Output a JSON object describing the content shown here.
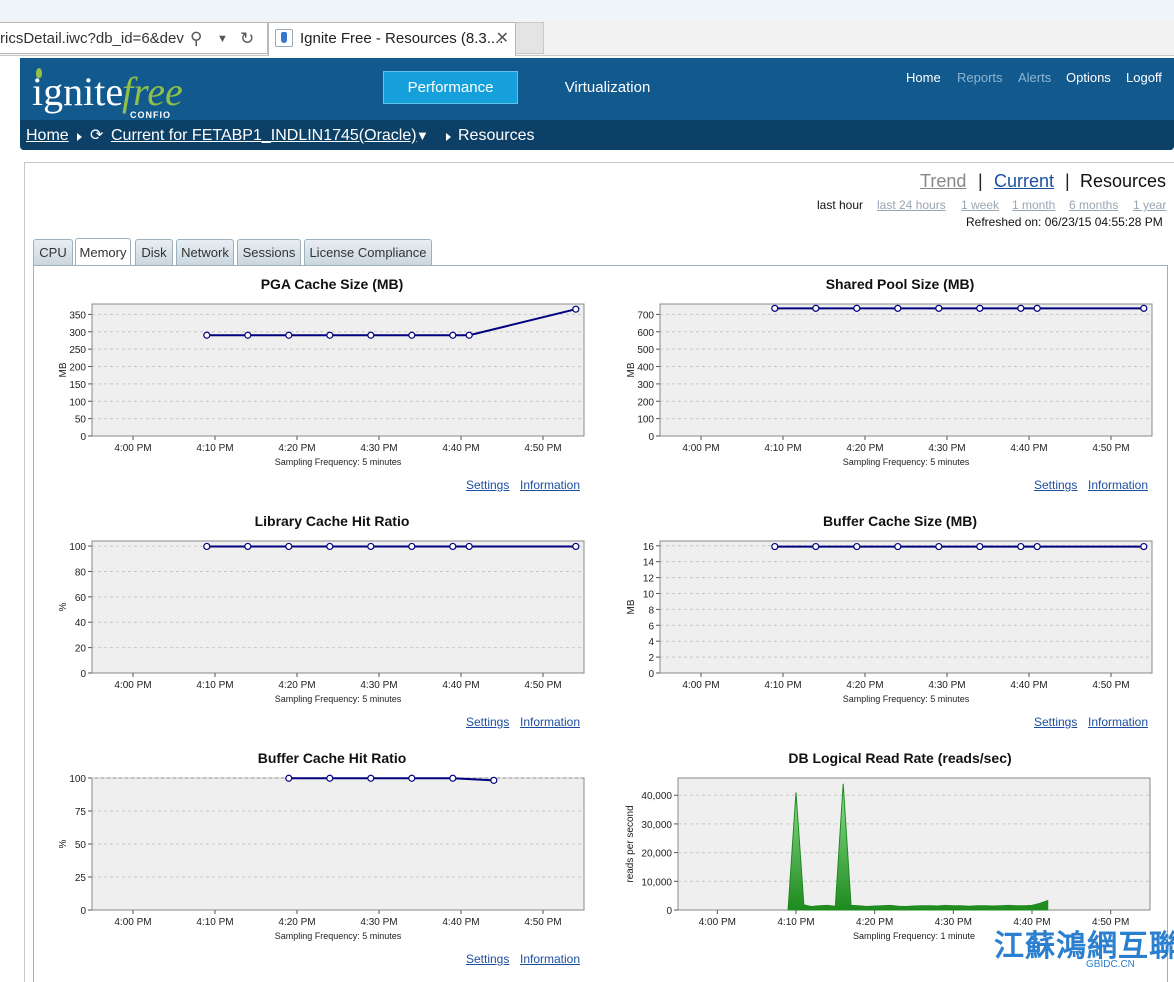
{
  "browser": {
    "address_text": "ricsDetail.iwc?db_id=6&dev",
    "tab_title": "Ignite Free - Resources (8.3....",
    "tab_close": "✕"
  },
  "header": {
    "logo_text_main": "ignite",
    "logo_text_accent": "free",
    "logo_sub": "CONFIO",
    "nav": [
      "Performance",
      "Virtualization"
    ],
    "top_links": [
      "Home",
      "Reports",
      "Alerts",
      "Options",
      "Logoff"
    ]
  },
  "breadcrumb": {
    "home": "Home",
    "current": "Current for FETABP1_INDLIN1745(Oracle)",
    "dropdown": "▼",
    "page": "Resources"
  },
  "view": {
    "trend": "Trend",
    "separator": "|",
    "current": "Current",
    "resources": "Resources"
  },
  "ranges": [
    "last hour",
    "last 24 hours",
    "1 week",
    "1 month",
    "6 months",
    "1 year"
  ],
  "refreshed": "Refreshed on: 06/23/15 04:55:28 PM",
  "tabs": [
    "CPU",
    "Memory",
    "Disk",
    "Network",
    "Sessions",
    "License Compliance"
  ],
  "links": {
    "settings": "Settings",
    "information": "Information"
  },
  "colors": {
    "line": "#00007f",
    "area": "#33aa33",
    "plot_bg": "#efefef",
    "header": "#12598e",
    "accent": "#16a0db"
  },
  "watermark": {
    "text": "江蘇鴻網互聯",
    "sub": "GBIDC.CN"
  },
  "chart_data": [
    {
      "type": "line",
      "title": "PGA Cache Size (MB)",
      "ylabel": "MB",
      "xlabel": "Sampling Frequency: 5 minutes",
      "x_ticks": [
        "4:00 PM",
        "4:10 PM",
        "4:20 PM",
        "4:30 PM",
        "4:40 PM",
        "4:50 PM"
      ],
      "xlim": [
        55,
        115
      ],
      "y_ticks": [
        0,
        50,
        100,
        150,
        200,
        250,
        300,
        350
      ],
      "ylim": [
        0,
        380
      ],
      "x": [
        69,
        74,
        79,
        84,
        89,
        94,
        99,
        101,
        114
      ],
      "y": [
        290,
        290,
        290,
        290,
        290,
        290,
        290,
        290,
        365
      ]
    },
    {
      "type": "line",
      "title": "Shared Pool Size (MB)",
      "ylabel": "MB",
      "xlabel": "Sampling Frequency: 5 minutes",
      "x_ticks": [
        "4:00 PM",
        "4:10 PM",
        "4:20 PM",
        "4:30 PM",
        "4:40 PM",
        "4:50 PM"
      ],
      "xlim": [
        55,
        115
      ],
      "y_ticks": [
        0,
        100,
        200,
        300,
        400,
        500,
        600,
        700
      ],
      "ylim": [
        0,
        760
      ],
      "x": [
        69,
        74,
        79,
        84,
        89,
        94,
        99,
        101,
        114
      ],
      "y": [
        735,
        735,
        735,
        735,
        735,
        735,
        735,
        735,
        735
      ]
    },
    {
      "type": "line",
      "title": "Library Cache Hit Ratio",
      "ylabel": "%",
      "xlabel": "Sampling Frequency: 5 minutes",
      "x_ticks": [
        "4:00 PM",
        "4:10 PM",
        "4:20 PM",
        "4:30 PM",
        "4:40 PM",
        "4:50 PM"
      ],
      "xlim": [
        55,
        115
      ],
      "y_ticks": [
        0,
        20,
        40,
        60,
        80,
        100
      ],
      "ylim": [
        0,
        104
      ],
      "x": [
        69,
        74,
        79,
        84,
        89,
        94,
        99,
        101,
        114
      ],
      "y": [
        99.7,
        99.7,
        99.7,
        99.7,
        99.7,
        99.7,
        99.7,
        99.7,
        99.7
      ]
    },
    {
      "type": "line",
      "title": "Buffer Cache Size (MB)",
      "ylabel": "MB",
      "xlabel": "Sampling Frequency: 5 minutes",
      "x_ticks": [
        "4:00 PM",
        "4:10 PM",
        "4:20 PM",
        "4:30 PM",
        "4:40 PM",
        "4:50 PM"
      ],
      "xlim": [
        55,
        115
      ],
      "y_ticks": [
        0,
        2,
        4,
        6,
        8,
        10,
        12,
        14,
        16
      ],
      "ylim": [
        0,
        16.6
      ],
      "x": [
        69,
        74,
        79,
        84,
        89,
        94,
        99,
        101,
        114
      ],
      "y": [
        15.9,
        15.9,
        15.9,
        15.9,
        15.9,
        15.9,
        15.9,
        15.9,
        15.9
      ]
    },
    {
      "type": "line",
      "title": "Buffer Cache Hit Ratio",
      "ylabel": "%",
      "xlabel": "Sampling Frequency: 5 minutes",
      "x_ticks": [
        "4:00 PM",
        "4:10 PM",
        "4:20 PM",
        "4:30 PM",
        "4:40 PM",
        "4:50 PM"
      ],
      "xlim": [
        55,
        115
      ],
      "y_ticks": [
        0,
        25,
        50,
        75,
        100
      ],
      "ylim": [
        0,
        100
      ],
      "x": [
        79,
        84,
        89,
        94,
        99,
        104
      ],
      "y": [
        99.8,
        99.8,
        99.8,
        99.8,
        99.8,
        98.2
      ]
    },
    {
      "type": "area",
      "title": "DB Logical Read Rate (reads/sec)",
      "ylabel": "reads per second",
      "xlabel": "Sampling Frequency: 1 minute",
      "x_ticks": [
        "4:00 PM",
        "4:10 PM",
        "4:20 PM",
        "4:30 PM",
        "4:40 PM",
        "4:50 PM"
      ],
      "xlim": [
        55,
        115
      ],
      "y_ticks": [
        "0",
        "10,000",
        "20,000",
        "30,000",
        "40,000"
      ],
      "ylim": [
        0,
        46000
      ],
      "x": [
        69,
        70,
        71,
        72,
        73,
        74,
        75,
        76,
        77,
        78,
        79,
        80,
        81,
        82,
        83,
        84,
        85,
        86,
        87,
        88,
        89,
        90,
        91,
        92,
        93,
        94,
        95,
        96,
        97,
        98,
        99,
        100,
        101,
        102
      ],
      "y": [
        500,
        41000,
        1800,
        1200,
        1500,
        1600,
        1300,
        44000,
        1600,
        1500,
        1200,
        1400,
        1500,
        1600,
        1300,
        1200,
        1400,
        1500,
        1500,
        1400,
        1600,
        1500,
        1500,
        1300,
        1500,
        1500,
        1400,
        1500,
        1600,
        1500,
        1500,
        1600,
        2300,
        3300
      ]
    }
  ]
}
